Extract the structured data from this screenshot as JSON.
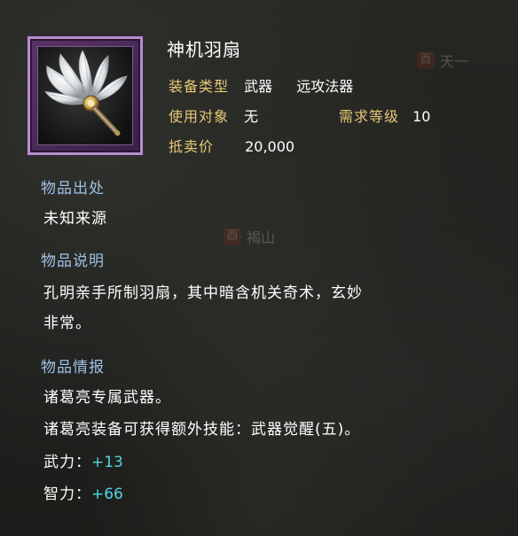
{
  "item": {
    "name": "神机羽扇",
    "icon": "feather-fan-icon",
    "icon_frame_color": "#b48fc8",
    "type_label": "装备类型",
    "type_value": "武器",
    "subtype_value": "远攻法器",
    "target_label": "使用对象",
    "target_value": "无",
    "level_label": "需求等级",
    "level_value": "10",
    "price_label": "抵卖价",
    "price_value": "20,000"
  },
  "sections": {
    "origin": {
      "heading": "物品出处",
      "text": "未知来源"
    },
    "description": {
      "heading": "物品说明",
      "line1": "孔明亲手所制羽扇，其中暗含机关奇术，玄妙",
      "line2": "非常。"
    },
    "info": {
      "heading": "物品情报",
      "line1": "诸葛亮专属武器。",
      "line2": "诸葛亮装备可获得额外技能：武器觉醒(五)。"
    }
  },
  "stats": [
    {
      "label": "武力：",
      "value": "+13"
    },
    {
      "label": "智力：",
      "value": "+66"
    }
  ],
  "colors": {
    "label_gold": "#e8c878",
    "heading_blue": "#9fc0e4",
    "stat_cyan": "#4fd6e6",
    "text_white": "#ffffff"
  },
  "background_map": {
    "marker1_seal": "酉",
    "marker1_text": "天一",
    "marker2_seal": "酉",
    "marker2_text": "褐山"
  }
}
